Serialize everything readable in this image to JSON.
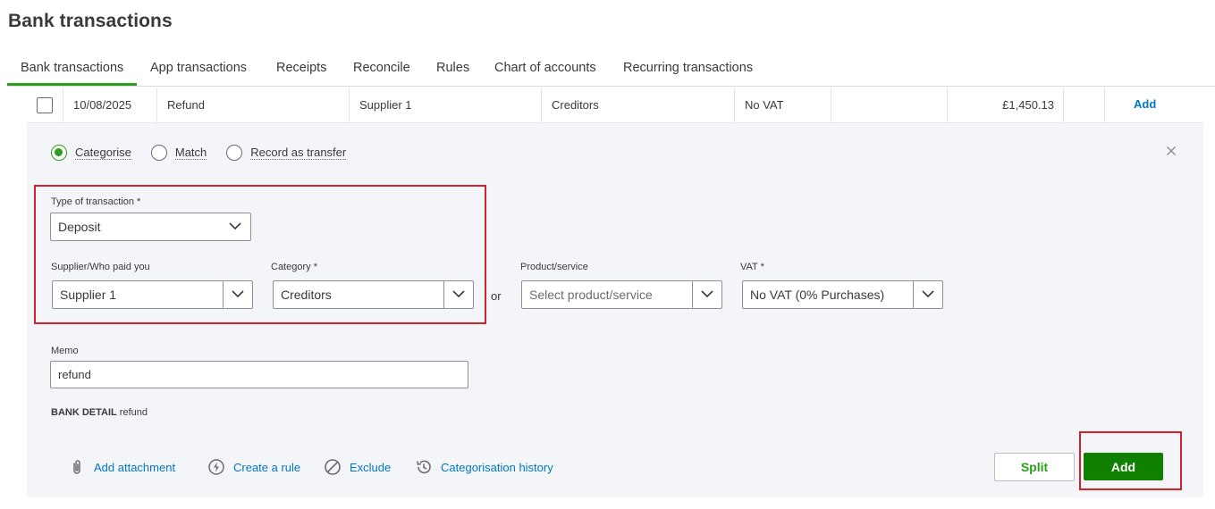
{
  "page": {
    "title": "Bank transactions"
  },
  "tabs": [
    {
      "label": "Bank transactions",
      "active": true
    },
    {
      "label": "App transactions"
    },
    {
      "label": "Receipts"
    },
    {
      "label": "Reconcile"
    },
    {
      "label": "Rules"
    },
    {
      "label": "Chart of accounts"
    },
    {
      "label": "Recurring transactions"
    }
  ],
  "row": {
    "date": "10/08/2025",
    "description": "Refund",
    "payee": "Supplier 1",
    "category": "Creditors",
    "vat": "No VAT",
    "spent": "",
    "received": "£1,450.13",
    "action": "Add"
  },
  "panel": {
    "radios": [
      {
        "label": "Categorise",
        "checked": true
      },
      {
        "label": "Match",
        "checked": false
      },
      {
        "label": "Record as transfer",
        "checked": false
      }
    ],
    "close_icon": "close-icon",
    "type_label": "Type of transaction *",
    "type_value": "Deposit",
    "supplier_label": "Supplier/Who paid you",
    "supplier_value": "Supplier 1",
    "category_label": "Category *",
    "category_value": "Creditors",
    "or_text": "or",
    "product_label": "Product/service",
    "product_placeholder": "Select product/service",
    "vat_label": "VAT *",
    "vat_value": "No VAT (0% Purchases)",
    "memo_label": "Memo",
    "memo_value": "refund",
    "bank_detail_label": "BANK DETAIL",
    "bank_detail_value": "refund",
    "links": [
      {
        "label": "Add attachment",
        "icon": "paperclip-icon"
      },
      {
        "label": "Create a rule",
        "icon": "lightning-icon"
      },
      {
        "label": "Exclude",
        "icon": "exclude-icon"
      },
      {
        "label": "Categorisation history",
        "icon": "history-icon"
      }
    ],
    "split_label": "Split",
    "add_label": "Add"
  },
  "colors": {
    "accent_green": "#2ca01c",
    "button_green": "#108000",
    "link_blue": "#0077c5",
    "highlight_red": "#d4202a",
    "panel_bg": "#f4f5f8"
  }
}
